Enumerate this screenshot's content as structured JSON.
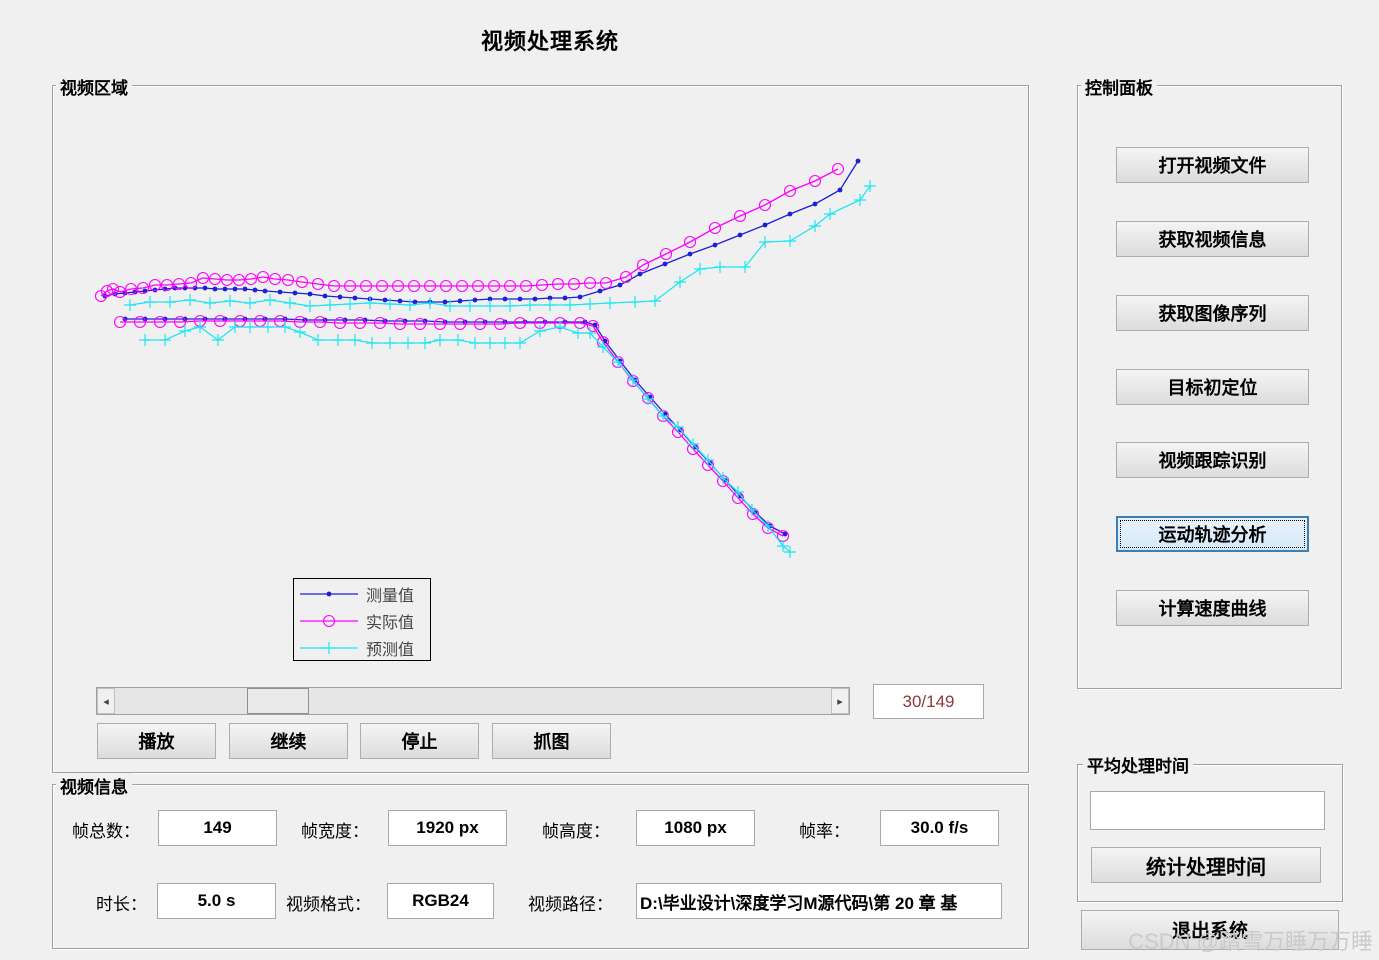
{
  "app": {
    "title": "视频处理系统"
  },
  "video_area": {
    "label": "视频区域",
    "legend": [
      {
        "label": "测量值",
        "color": "#1f1fd6",
        "marker": "dot"
      },
      {
        "label": "实际值",
        "color": "#ff00ff",
        "marker": "circle"
      },
      {
        "label": "预测值",
        "color": "#1ee6f0",
        "marker": "plus"
      }
    ],
    "frame_counter": "30/149",
    "frame_value": 30,
    "frame_total": 149,
    "buttons": {
      "play": "播放",
      "resume": "继续",
      "stop": "停止",
      "capture": "抓图"
    }
  },
  "control_panel": {
    "label": "控制面板",
    "buttons": [
      "打开视频文件",
      "获取视频信息",
      "获取图像序列",
      "目标初定位",
      "视频跟踪识别",
      "运动轨迹分析",
      "计算速度曲线"
    ],
    "focused_index": 5
  },
  "avg_time": {
    "label": "平均处理时间",
    "value": "",
    "button": "统计处理时间"
  },
  "exit_button": "退出系统",
  "video_info": {
    "label": "视频信息",
    "total_frames_label": "帧总数：",
    "total_frames": "149",
    "width_label": "帧宽度：",
    "width": "1920 px",
    "height_label": "帧高度：",
    "height": "1080 px",
    "fps_label": "帧率：",
    "fps": "30.0 f/s",
    "duration_label": "时长：",
    "duration": "5.0 s",
    "format_label": "视频格式：",
    "format": "RGB24",
    "path_label": "视频路径：",
    "path": "D:\\毕业设计\\深度学习M源代码\\第 20 章 基"
  },
  "watermark": "CSDN @踏雪万睡万万睡",
  "chart_data": {
    "type": "line",
    "axes_visible": false,
    "series": [
      {
        "name": "测量值",
        "color": "#1f1fd6",
        "marker": "dot",
        "segments": [
          {
            "x": [
              105,
              115,
              125,
              135,
              145,
              155,
              165,
              175,
              185,
              195,
              205,
              215,
              225,
              235,
              245,
              255,
              265,
              280,
              295,
              310,
              325,
              340,
              355,
              370,
              385,
              400,
              415,
              430,
              445,
              460,
              475,
              490,
              505,
              520,
              535,
              550,
              565,
              580,
              600,
              620,
              640,
              665,
              690,
              715,
              740,
              765,
              790,
              815,
              840,
              858
            ],
            "y": [
              -296,
              -294,
              -293,
              -292,
              -291,
              -290,
              -289,
              -288,
              -288,
              -288,
              -288,
              -289,
              -289,
              -289,
              -289,
              -290,
              -291,
              -292,
              -293,
              -294,
              -296,
              -297,
              -298,
              -299,
              -300,
              -301,
              -302,
              -302,
              -302,
              -301,
              -300,
              -299,
              -299,
              -299,
              -299,
              -298,
              -298,
              -297,
              -291,
              -285,
              -274,
              -264,
              -254,
              -245,
              -235,
              -225,
              -214,
              -204,
              -190,
              -161
            ]
          },
          {
            "x": [
              125,
              145,
              165,
              185,
              205,
              225,
              245,
              265,
              285,
              305,
              325,
              345,
              365,
              385,
              405,
              425,
              445,
              465,
              485,
              505,
              525,
              545,
              565,
              585,
              595,
              605,
              620,
              635,
              650,
              665,
              680,
              695,
              710,
              725,
              740,
              755,
              770,
              785
            ],
            "y": [
              -319,
              -319,
              -319,
              -319,
              -319,
              -319,
              -319,
              -319,
              -319,
              -320,
              -320,
              -320,
              -320,
              -321,
              -321,
              -321,
              -322,
              -322,
              -322,
              -322,
              -322,
              -322,
              -322,
              -322,
              -325,
              -341,
              -361,
              -380,
              -397,
              -414,
              -430,
              -447,
              -463,
              -480,
              -496,
              -512,
              -526,
              -534
            ]
          }
        ]
      },
      {
        "name": "实际值",
        "color": "#ff00ff",
        "marker": "circle",
        "segments": [
          {
            "x": [
              101,
              107,
              113,
              120,
              131,
              143,
              155,
              167,
              179,
              191,
              203,
              215,
              227,
              239,
              251,
              263,
              275,
              288,
              302,
              318,
              334,
              350,
              366,
              382,
              398,
              414,
              430,
              446,
              462,
              478,
              494,
              510,
              526,
              542,
              558,
              574,
              590,
              606,
              626,
              643,
              666,
              690,
              715,
              740,
              765,
              790,
              815,
              838
            ],
            "y": [
              -296,
              -291,
              -289,
              -292,
              -289,
              -288,
              -285,
              -285,
              -284,
              -283,
              -278,
              -279,
              -280,
              -280,
              -279,
              -277,
              -279,
              -280,
              -282,
              -284,
              -286,
              -286,
              -286,
              -286,
              -286,
              -286,
              -286,
              -286,
              -286,
              -286,
              -286,
              -286,
              -286,
              -285,
              -284,
              -284,
              -283,
              -283,
              -277,
              -265,
              -254,
              -242,
              -228,
              -216,
              -205,
              -191,
              -181,
              -169
            ]
          },
          {
            "x": [
              120,
              140,
              160,
              180,
              200,
              220,
              240,
              260,
              280,
              300,
              320,
              340,
              360,
              380,
              400,
              420,
              440,
              460,
              480,
              500,
              520,
              540,
              560,
              580,
              593,
              603,
              618,
              633,
              648,
              663,
              678,
              693,
              708,
              723,
              738,
              753,
              768,
              783
            ],
            "y": [
              -322,
              -322,
              -322,
              -322,
              -321,
              -321,
              -321,
              -321,
              -321,
              -322,
              -322,
              -323,
              -323,
              -323,
              -324,
              -324,
              -324,
              -324,
              -324,
              -324,
              -323,
              -323,
              -323,
              -323,
              -326,
              -342,
              -362,
              -381,
              -398,
              -416,
              -432,
              -449,
              -465,
              -481,
              -498,
              -514,
              -528,
              -536
            ]
          }
        ]
      },
      {
        "name": "预测值",
        "color": "#1ee6f0",
        "marker": "plus",
        "segments": [
          {
            "x": [
              130,
              150,
              170,
              190,
              210,
              230,
              250,
              270,
              290,
              310,
              330,
              350,
              370,
              390,
              410,
              430,
              450,
              470,
              490,
              510,
              530,
              550,
              570,
              590,
              610,
              635,
              655,
              680,
              700,
              720,
              745,
              765,
              790,
              815,
              830,
              860,
              870
            ],
            "y": [
              -305,
              -302,
              -302,
              -300,
              -303,
              -301,
              -303,
              -300,
              -303,
              -306,
              -305,
              -304,
              -303,
              -304,
              -305,
              -303,
              -306,
              -306,
              -306,
              -306,
              -305,
              -305,
              -305,
              -304,
              -303,
              -302,
              -301,
              -282,
              -269,
              -267,
              -267,
              -242,
              -241,
              -226,
              -214,
              -200,
              -186
            ]
          },
          {
            "x": [
              145,
              165,
              185,
              200,
              218,
              235,
              250,
              268,
              285,
              300,
              318,
              338,
              355,
              372,
              390,
              408,
              425,
              440,
              458,
              475,
              490,
              505,
              520,
              540,
              560,
              578,
              590,
              603,
              618,
              633,
              648,
              663,
              678,
              693,
              708,
              723,
              738,
              752,
              768,
              783,
              790
            ],
            "y": [
              -340,
              -340,
              -331,
              -327,
              -340,
              -327,
              -327,
              -327,
              -327,
              -332,
              -340,
              -340,
              -340,
              -343,
              -343,
              -343,
              -343,
              -340,
              -340,
              -343,
              -343,
              -343,
              -343,
              -331,
              -327,
              -333,
              -333,
              -347,
              -362,
              -380,
              -399,
              -416,
              -427,
              -444,
              -460,
              -478,
              -492,
              -510,
              -526,
              -546,
              -552
            ]
          }
        ]
      }
    ]
  }
}
